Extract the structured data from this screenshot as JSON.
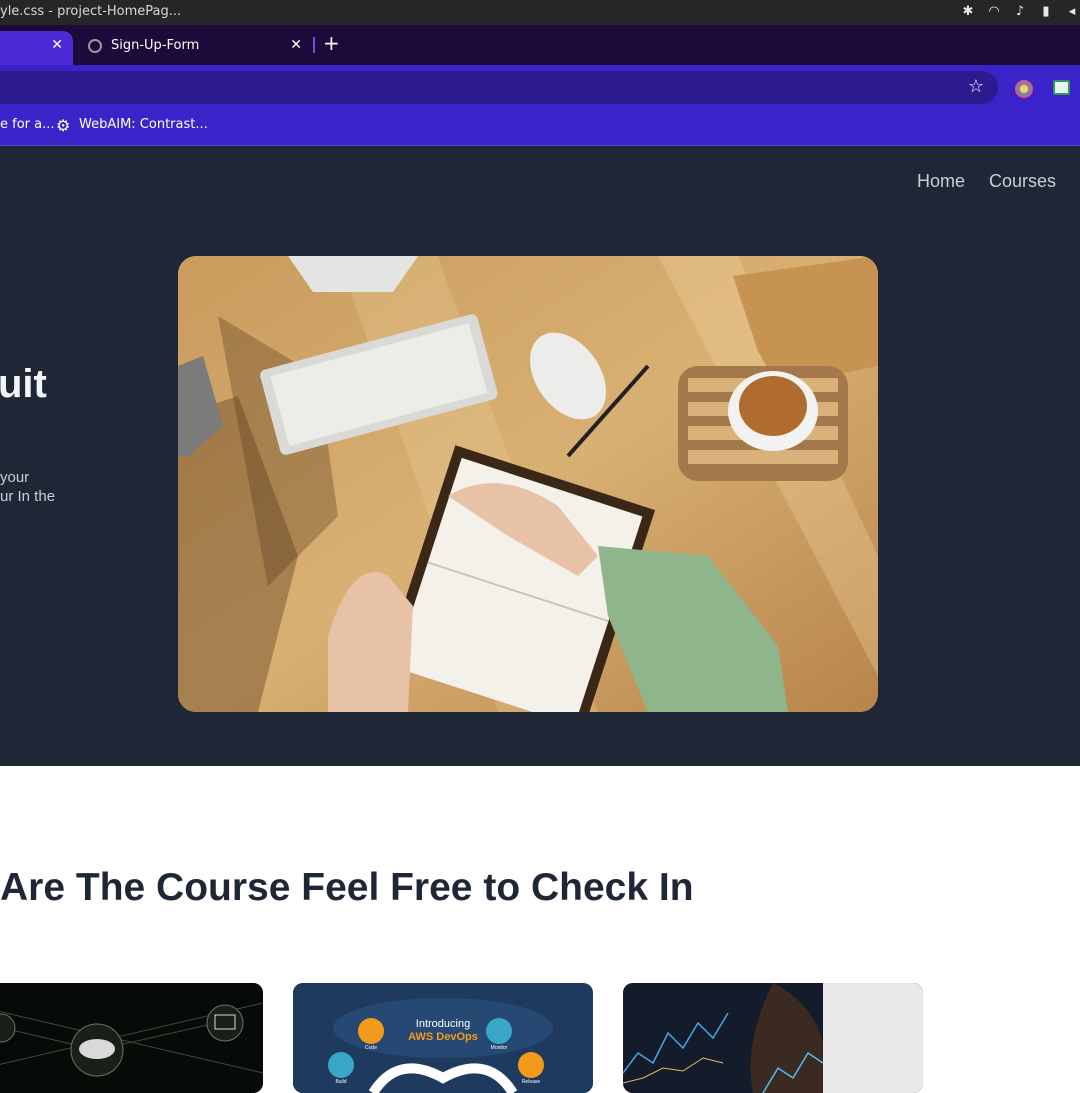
{
  "system": {
    "window_title": "yle.css - project-HomePag..."
  },
  "browser": {
    "active_tab": {
      "close_glyph": "✕"
    },
    "tabs": [
      {
        "label": "Sign-Up-Form",
        "close_glyph": "✕"
      }
    ],
    "new_tab_glyph": "+",
    "star_glyph": "☆",
    "bookmarks": [
      {
        "label": "e for a..."
      },
      {
        "label": "WebAIM: Contrast..."
      }
    ]
  },
  "hero": {
    "nav": [
      {
        "label": "Home"
      },
      {
        "label": "Courses"
      }
    ],
    "heading": "uit",
    "text_lines": [
      "your",
      "ur In the"
    ]
  },
  "section": {
    "title": "Are The Course Feel Free to Check In"
  },
  "cards": [
    {
      "image": "cloud-network-image"
    },
    {
      "image": "aws-devops-image",
      "title_line1": "Introducing",
      "title_line2": "AWS DevOps",
      "icon_labels": [
        "Code",
        "Monitor",
        "Build",
        "Release"
      ]
    },
    {
      "image": "stock-chart-image"
    }
  ],
  "colors": {
    "hero_bg": "#1f2737",
    "bookmark_bar": "#3a23c9",
    "tab_active": "#4a2bd6",
    "section_text": "#1f2737"
  }
}
